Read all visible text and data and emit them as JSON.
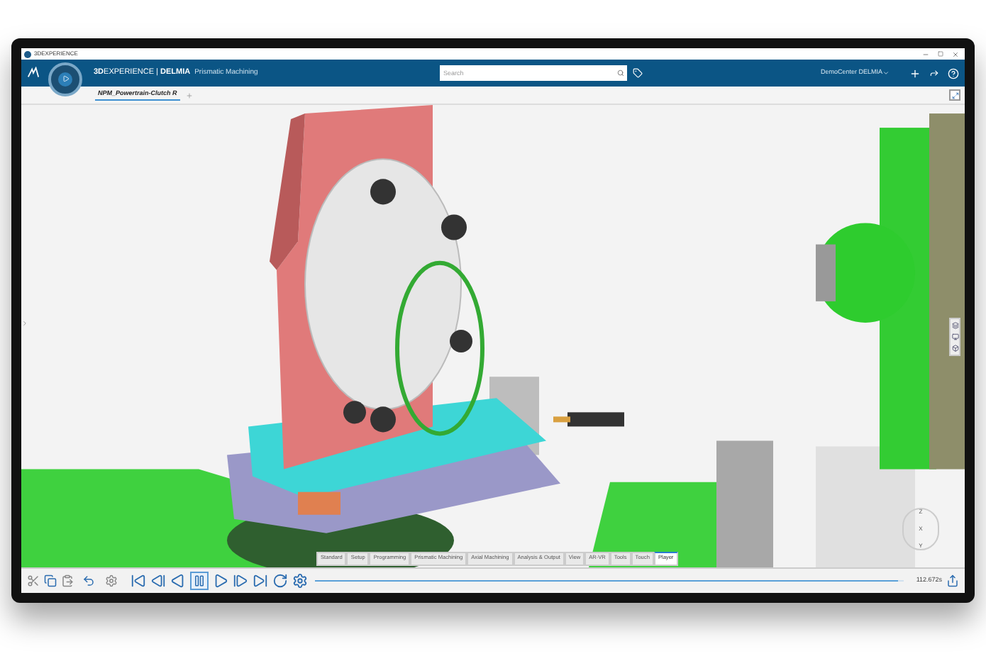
{
  "window": {
    "title": "3DEXPERIENCE"
  },
  "top_bar": {
    "brand": "**3D**EXPERIENCE | **DELMIA**",
    "app": "Prismatic Machining",
    "search": {
      "placeholder": "Search"
    },
    "user": "DemoCenter DELMIA"
  },
  "document_tabs": [
    {
      "label": "NPM_Powertrain-Clutch R",
      "selected": true
    }
  ],
  "workbench_tabs": [
    {
      "label": "Standard",
      "selected": false
    },
    {
      "label": "Setup",
      "selected": false
    },
    {
      "label": "Programming",
      "selected": false
    },
    {
      "label": "Prismatic Machining",
      "selected": false
    },
    {
      "label": "Axial Machining",
      "selected": false
    },
    {
      "label": "Analysis & Output",
      "selected": false
    },
    {
      "label": "View",
      "selected": false
    },
    {
      "label": "AR-VR",
      "selected": false
    },
    {
      "label": "Tools",
      "selected": false
    },
    {
      "label": "Touch",
      "selected": false
    },
    {
      "label": "Player",
      "selected": true
    }
  ],
  "compass_axes": [
    "Z",
    "X",
    "Y"
  ],
  "player": {
    "level": 0.99,
    "time": "112.672s"
  }
}
